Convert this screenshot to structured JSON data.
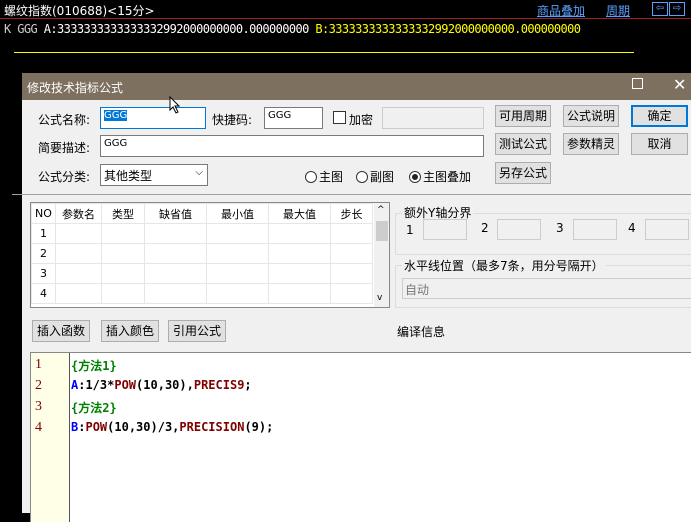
{
  "topbar": {
    "title": "螺纹指数(010688)<15分>",
    "overlay": "商品叠加",
    "period": "周期",
    "prev": "⇦",
    "next": "⇨"
  },
  "values": {
    "k": "K",
    "name": "GGG",
    "a": "A:3333333333333332992000000000.000000000",
    "b": "B:3333333333333332992000000000.000000000"
  },
  "colors": {
    "a": "#ffffff",
    "b": "#ffff00",
    "line": "#ffff00",
    "title_bar": "#7d705f"
  },
  "dialog": {
    "title": "修改技术指标公式",
    "name_label": "公式名称:",
    "name_value": "GGG",
    "hotkey_label": "快捷码:",
    "hotkey_value": "GGG",
    "encrypt_label": "加密",
    "encrypt_checked": false,
    "desc_label": "简要描述:",
    "desc_value": "GGG",
    "category_label": "公式分类:",
    "category_value": "其他类型",
    "radios": [
      {
        "label": "主图",
        "checked": false
      },
      {
        "label": "副图",
        "checked": false
      },
      {
        "label": "主图叠加",
        "checked": true
      }
    ],
    "buttons": {
      "periods": "可用周期",
      "explain": "公式说明",
      "ok": "确定",
      "test": "测试公式",
      "wizard": "参数精灵",
      "cancel": "取消",
      "save_as": "另存公式",
      "insert_func": "插入函数",
      "insert_color": "插入颜色",
      "ref_formula": "引用公式"
    },
    "param_table": {
      "headers": [
        "NO",
        "参数名",
        "类型",
        "缺省值",
        "最小值",
        "最大值",
        "步长"
      ],
      "rows": [
        "1",
        "2",
        "3",
        "4"
      ]
    },
    "yaxis": {
      "title": "额外Y轴分界",
      "labels": [
        "1",
        "2",
        "3",
        "4"
      ]
    },
    "hline": {
      "title": "水平线位置（最多7条，用分号隔开）",
      "value": "自动"
    },
    "compile_label": "编译信息"
  },
  "code": {
    "line_numbers": [
      "1",
      "2",
      "3",
      "4"
    ],
    "lines": [
      [
        {
          "t": "{方法1}",
          "c": "#008000"
        }
      ],
      [
        {
          "t": "A",
          "c": "#0000ff"
        },
        {
          "t": ":1/3*",
          "c": "#000"
        },
        {
          "t": "POW",
          "c": "#800000"
        },
        {
          "t": "(10,30),",
          "c": "#000"
        },
        {
          "t": "PRECIS9",
          "c": "#800000"
        },
        {
          "t": ";",
          "c": "#000"
        }
      ],
      [
        {
          "t": "{方法2}",
          "c": "#008000"
        }
      ],
      [
        {
          "t": "B",
          "c": "#0000ff"
        },
        {
          "t": ":",
          "c": "#000"
        },
        {
          "t": "POW",
          "c": "#800000"
        },
        {
          "t": "(10,30)/3,",
          "c": "#000"
        },
        {
          "t": "PRECISION",
          "c": "#800000"
        },
        {
          "t": "(9);",
          "c": "#000"
        }
      ]
    ]
  }
}
